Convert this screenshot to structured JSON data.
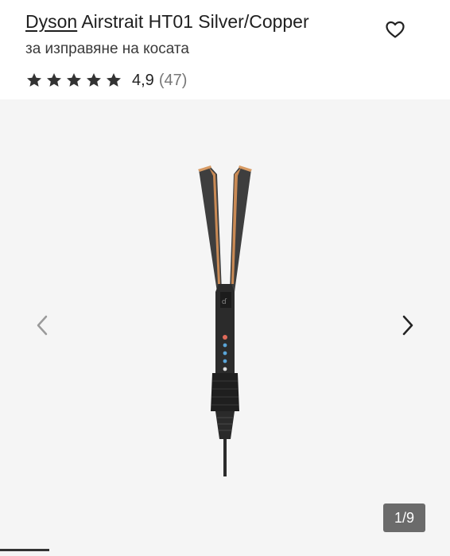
{
  "product": {
    "brand": "Dyson",
    "name": "Airstrait HT01 Silver/Copper",
    "subtitle": "за изправяне на косата",
    "rating": "4,9",
    "review_count": "(47)",
    "stars_filled": 5
  },
  "gallery": {
    "counter": "1/9"
  },
  "icons": {
    "favorite": "heart-outline-icon",
    "prev": "chevron-left-icon",
    "next": "chevron-right-icon",
    "star": "star-icon"
  },
  "colors": {
    "star": "#333333",
    "gallery_bg": "#f5f5f5",
    "copper_accent": "#c98a55",
    "counter_bg": "#6b6b6b"
  }
}
